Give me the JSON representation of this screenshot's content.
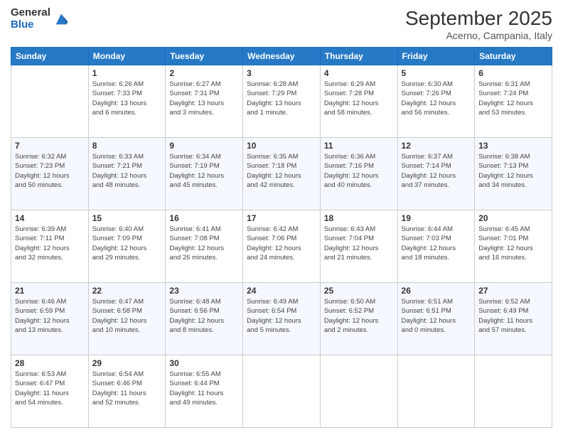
{
  "header": {
    "logo_general": "General",
    "logo_blue": "Blue",
    "month_title": "September 2025",
    "location": "Acerno, Campania, Italy"
  },
  "days": [
    "Sunday",
    "Monday",
    "Tuesday",
    "Wednesday",
    "Thursday",
    "Friday",
    "Saturday"
  ],
  "weeks": [
    [
      {
        "day": "",
        "info": ""
      },
      {
        "day": "1",
        "info": "Sunrise: 6:26 AM\nSunset: 7:33 PM\nDaylight: 13 hours\nand 6 minutes."
      },
      {
        "day": "2",
        "info": "Sunrise: 6:27 AM\nSunset: 7:31 PM\nDaylight: 13 hours\nand 3 minutes."
      },
      {
        "day": "3",
        "info": "Sunrise: 6:28 AM\nSunset: 7:29 PM\nDaylight: 13 hours\nand 1 minute."
      },
      {
        "day": "4",
        "info": "Sunrise: 6:29 AM\nSunset: 7:28 PM\nDaylight: 12 hours\nand 58 minutes."
      },
      {
        "day": "5",
        "info": "Sunrise: 6:30 AM\nSunset: 7:26 PM\nDaylight: 12 hours\nand 56 minutes."
      },
      {
        "day": "6",
        "info": "Sunrise: 6:31 AM\nSunset: 7:24 PM\nDaylight: 12 hours\nand 53 minutes."
      }
    ],
    [
      {
        "day": "7",
        "info": "Sunrise: 6:32 AM\nSunset: 7:23 PM\nDaylight: 12 hours\nand 50 minutes."
      },
      {
        "day": "8",
        "info": "Sunrise: 6:33 AM\nSunset: 7:21 PM\nDaylight: 12 hours\nand 48 minutes."
      },
      {
        "day": "9",
        "info": "Sunrise: 6:34 AM\nSunset: 7:19 PM\nDaylight: 12 hours\nand 45 minutes."
      },
      {
        "day": "10",
        "info": "Sunrise: 6:35 AM\nSunset: 7:18 PM\nDaylight: 12 hours\nand 42 minutes."
      },
      {
        "day": "11",
        "info": "Sunrise: 6:36 AM\nSunset: 7:16 PM\nDaylight: 12 hours\nand 40 minutes."
      },
      {
        "day": "12",
        "info": "Sunrise: 6:37 AM\nSunset: 7:14 PM\nDaylight: 12 hours\nand 37 minutes."
      },
      {
        "day": "13",
        "info": "Sunrise: 6:38 AM\nSunset: 7:13 PM\nDaylight: 12 hours\nand 34 minutes."
      }
    ],
    [
      {
        "day": "14",
        "info": "Sunrise: 6:39 AM\nSunset: 7:11 PM\nDaylight: 12 hours\nand 32 minutes."
      },
      {
        "day": "15",
        "info": "Sunrise: 6:40 AM\nSunset: 7:09 PM\nDaylight: 12 hours\nand 29 minutes."
      },
      {
        "day": "16",
        "info": "Sunrise: 6:41 AM\nSunset: 7:08 PM\nDaylight: 12 hours\nand 26 minutes."
      },
      {
        "day": "17",
        "info": "Sunrise: 6:42 AM\nSunset: 7:06 PM\nDaylight: 12 hours\nand 24 minutes."
      },
      {
        "day": "18",
        "info": "Sunrise: 6:43 AM\nSunset: 7:04 PM\nDaylight: 12 hours\nand 21 minutes."
      },
      {
        "day": "19",
        "info": "Sunrise: 6:44 AM\nSunset: 7:03 PM\nDaylight: 12 hours\nand 18 minutes."
      },
      {
        "day": "20",
        "info": "Sunrise: 6:45 AM\nSunset: 7:01 PM\nDaylight: 12 hours\nand 16 minutes."
      }
    ],
    [
      {
        "day": "21",
        "info": "Sunrise: 6:46 AM\nSunset: 6:59 PM\nDaylight: 12 hours\nand 13 minutes."
      },
      {
        "day": "22",
        "info": "Sunrise: 6:47 AM\nSunset: 6:58 PM\nDaylight: 12 hours\nand 10 minutes."
      },
      {
        "day": "23",
        "info": "Sunrise: 6:48 AM\nSunset: 6:56 PM\nDaylight: 12 hours\nand 8 minutes."
      },
      {
        "day": "24",
        "info": "Sunrise: 6:49 AM\nSunset: 6:54 PM\nDaylight: 12 hours\nand 5 minutes."
      },
      {
        "day": "25",
        "info": "Sunrise: 6:50 AM\nSunset: 6:52 PM\nDaylight: 12 hours\nand 2 minutes."
      },
      {
        "day": "26",
        "info": "Sunrise: 6:51 AM\nSunset: 6:51 PM\nDaylight: 12 hours\nand 0 minutes."
      },
      {
        "day": "27",
        "info": "Sunrise: 6:52 AM\nSunset: 6:49 PM\nDaylight: 11 hours\nand 57 minutes."
      }
    ],
    [
      {
        "day": "28",
        "info": "Sunrise: 6:53 AM\nSunset: 6:47 PM\nDaylight: 11 hours\nand 54 minutes."
      },
      {
        "day": "29",
        "info": "Sunrise: 6:54 AM\nSunset: 6:46 PM\nDaylight: 11 hours\nand 52 minutes."
      },
      {
        "day": "30",
        "info": "Sunrise: 6:55 AM\nSunset: 6:44 PM\nDaylight: 11 hours\nand 49 minutes."
      },
      {
        "day": "",
        "info": ""
      },
      {
        "day": "",
        "info": ""
      },
      {
        "day": "",
        "info": ""
      },
      {
        "day": "",
        "info": ""
      }
    ]
  ]
}
